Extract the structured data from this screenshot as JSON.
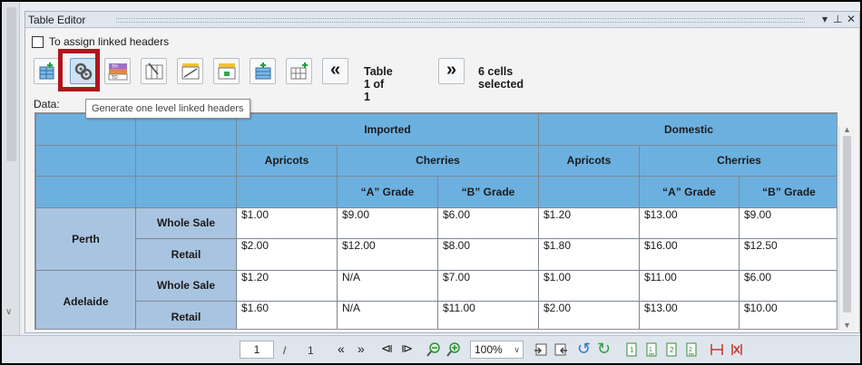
{
  "panel": {
    "title": "Table Editor",
    "controls": {
      "dropdown": "▾",
      "pin": "⊥",
      "close": "✕"
    }
  },
  "options": {
    "assign_linked_headers_label": "To assign linked headers",
    "checked": false
  },
  "toolbar": {
    "table_label": "Table 1 of 1",
    "selection_label": "6 cells selected",
    "prev_symbol": "«",
    "next_symbol": "»",
    "icons": [
      "insert-table-icon",
      "linked-headers-icon",
      "th-td-icon",
      "column-grid-icon",
      "split-header-icon",
      "merge-cells-icon",
      "add-row-icon",
      "add-column-icon"
    ]
  },
  "data_label": "Data:",
  "tooltip": "Generate one level linked headers",
  "table": {
    "headers": {
      "imported": "Imported",
      "domestic": "Domestic",
      "apricots_1": "Apricots",
      "cherries_1": "Cherries",
      "apricots_2": "Apricots",
      "cherries_2": "Cherries",
      "grade_a_1": "“A” Grade",
      "grade_b_1": "“B” Grade",
      "grade_a_2": "“A” Grade",
      "grade_b_2": "“B” Grade"
    },
    "rows": [
      {
        "city": "Perth",
        "type": "Whole Sale",
        "values": [
          "$1.00",
          "$9.00",
          "$6.00",
          "$1.20",
          "$13.00",
          "$9.00"
        ]
      },
      {
        "city": "",
        "type": "Retail",
        "values": [
          "$2.00",
          "$12.00",
          "$8.00",
          "$1.80",
          "$16.00",
          "$12.50"
        ]
      },
      {
        "city": "Adelaide",
        "type": "Whole Sale",
        "values": [
          "$1.20",
          "N/A",
          "$7.00",
          "$1.00",
          "$11.00",
          "$6.00"
        ]
      },
      {
        "city": "",
        "type": "Retail",
        "values": [
          "$1.60",
          "N/A",
          "$11.00",
          "$2.00",
          "$13.00",
          "$10.00"
        ]
      }
    ]
  },
  "statusbar": {
    "page_current": "1",
    "page_separator": "/",
    "page_total": "1",
    "zoom": "100%"
  },
  "colors": {
    "header_blue": "#6cb0e0",
    "row_header_blue": "#a9c4e0",
    "highlight_red": "#b0141d"
  }
}
